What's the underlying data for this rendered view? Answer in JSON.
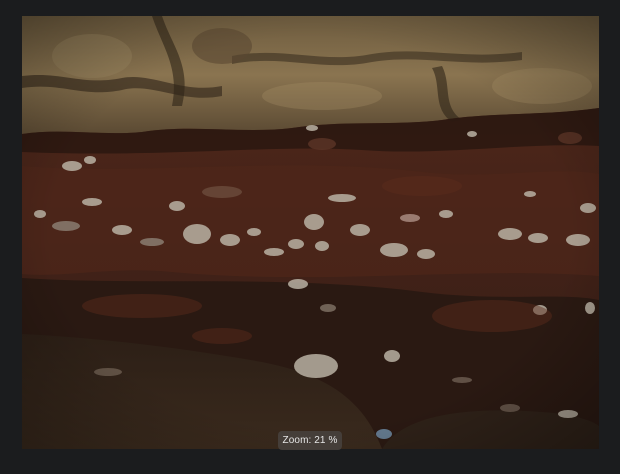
{
  "viewer": {
    "background_color": "#1b1c1e",
    "image": {
      "subject_icon": "photo-image",
      "palette": {
        "cliff_light": "#8c7752",
        "cliff_dark": "#4a3a27",
        "soil_red": "#4a2418",
        "soil_dark": "#2a1a12",
        "sand": "#3a2a1e",
        "pebble": "#b8b0a2"
      }
    },
    "zoom": {
      "label": "Zoom: 21 %",
      "value_percent": 21
    }
  }
}
